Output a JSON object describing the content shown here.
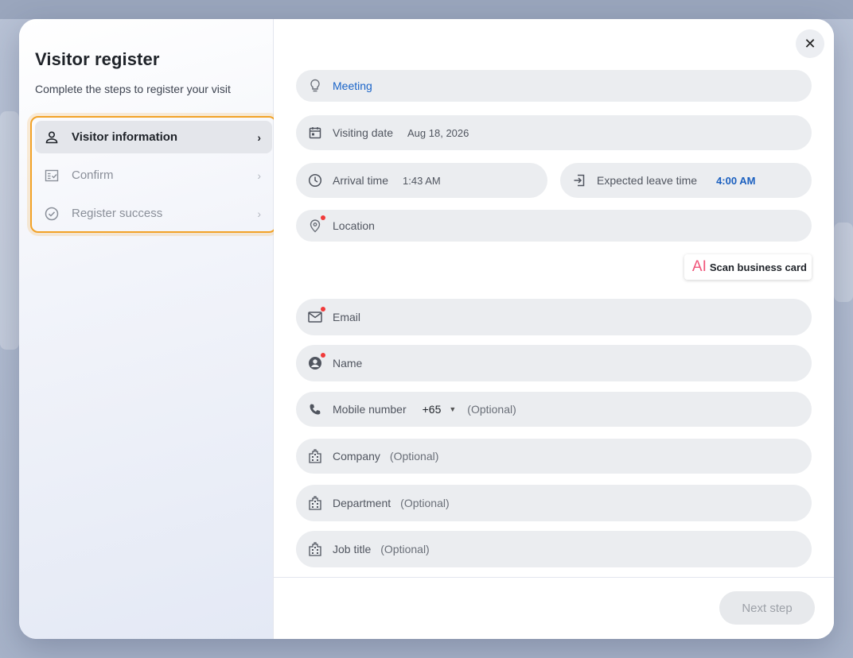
{
  "dialog": {
    "title": "Visitor register",
    "subtitle": "Complete the steps to register your visit",
    "close_icon": "close-icon"
  },
  "steps": [
    {
      "label": "Visitor information",
      "icon": "person-icon",
      "active": true
    },
    {
      "label": "Confirm",
      "icon": "checklist-icon",
      "active": false
    },
    {
      "label": "Register success",
      "icon": "check-circle-icon",
      "active": false
    }
  ],
  "form": {
    "purpose": {
      "value": "Meeting",
      "icon": "lightbulb-icon"
    },
    "visiting_date": {
      "label": "Visiting date",
      "value": "Aug 18, 2026",
      "icon": "calendar-icon"
    },
    "arrival_time": {
      "label": "Arrival time",
      "value": "1:43 AM",
      "icon": "clock-icon"
    },
    "leave_time": {
      "label": "Expected leave time",
      "value": "4:00 AM",
      "icon": "exit-icon"
    },
    "location": {
      "label": "Location",
      "icon": "location-pin-icon",
      "required": true
    },
    "scan_button": {
      "ai_label": "AI",
      "label": "Scan business card"
    },
    "email": {
      "label": "Email",
      "icon": "mail-icon",
      "required": true
    },
    "name": {
      "label": "Name",
      "icon": "person-circle-icon",
      "required": true
    },
    "mobile": {
      "label": "Mobile number",
      "country_code": "+65",
      "optional": "(Optional)",
      "icon": "phone-icon"
    },
    "company": {
      "label": "Company",
      "optional": "(Optional)",
      "icon": "building-icon"
    },
    "department": {
      "label": "Department",
      "optional": "(Optional)",
      "icon": "building-icon"
    },
    "job_title": {
      "label": "Job title",
      "optional": "(Optional)",
      "icon": "building-icon"
    }
  },
  "footer": {
    "next_label": "Next step"
  },
  "colors": {
    "accent_orange": "#f2a227",
    "link_blue": "#1a64c8",
    "required_red": "#f03a3a",
    "ai_pink": "#f0557a"
  }
}
